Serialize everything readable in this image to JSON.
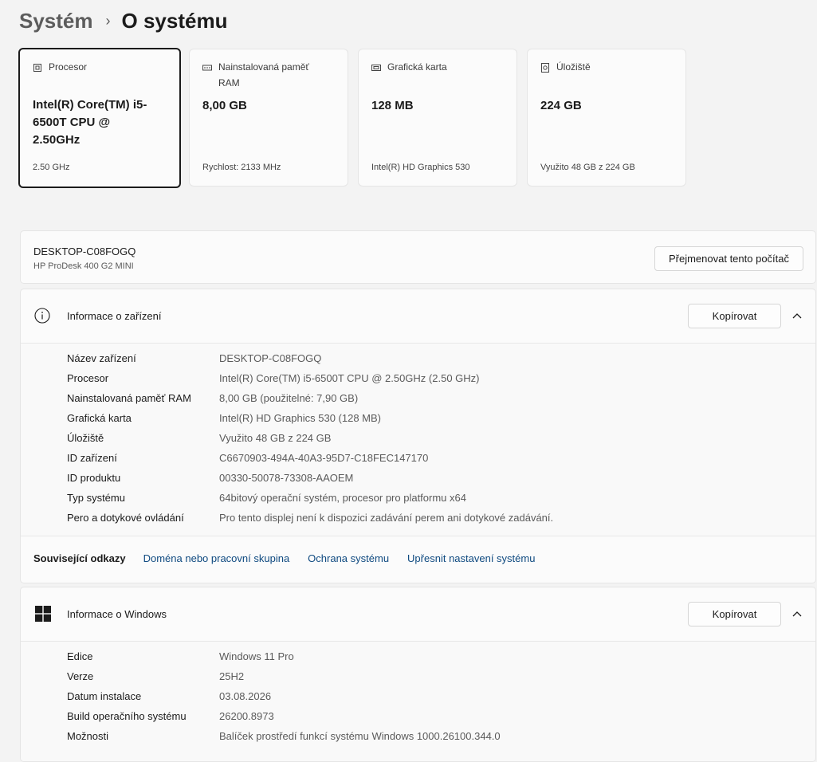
{
  "breadcrumb": {
    "parent": "Systém",
    "separator": "›",
    "current": "O systému"
  },
  "cards": [
    {
      "label": "Procesor",
      "value": "Intel(R) Core(TM) i5-6500T CPU @ 2.50GHz",
      "sub": "2.50 GHz",
      "icon": "processor-icon"
    },
    {
      "label": "Nainstalovaná paměť RAM",
      "value": "8,00 GB",
      "sub": "Rychlost: 2133 MHz",
      "icon": "memory-icon"
    },
    {
      "label": "Grafická karta",
      "value": "128 MB",
      "sub": "Intel(R) HD Graphics 530",
      "icon": "graphics-card-icon"
    },
    {
      "label": "Úložiště",
      "value": "224 GB",
      "sub": "Využito 48 GB z 224 GB",
      "icon": "storage-icon"
    }
  ],
  "pc": {
    "name": "DESKTOP-C08FOGQ",
    "model": "HP ProDesk 400 G2 MINI",
    "rename_label": "Přejmenovat tento počítač"
  },
  "device_info": {
    "title": "Informace o zařízení",
    "copy_label": "Kopírovat",
    "rows": [
      {
        "key": "Název zařízení",
        "value": "DESKTOP-C08FOGQ"
      },
      {
        "key": "Procesor",
        "value": "Intel(R) Core(TM) i5-6500T CPU @ 2.50GHz (2.50 GHz)"
      },
      {
        "key": "Nainstalovaná paměť RAM",
        "value": "8,00 GB (použitelné: 7,90 GB)"
      },
      {
        "key": "Grafická karta",
        "value": "Intel(R) HD Graphics 530 (128 MB)"
      },
      {
        "key": "Úložiště",
        "value": "Využito 48 GB z 224 GB"
      },
      {
        "key": "ID zařízení",
        "value": "C6670903-494A-40A3-95D7-C18FEC147170"
      },
      {
        "key": "ID produktu",
        "value": "00330-50078-73308-AAOEM"
      },
      {
        "key": "Typ systému",
        "value": "64bitový operační systém, procesor pro platformu x64"
      },
      {
        "key": "Pero a dotykové ovládání",
        "value": "Pro tento displej není k dispozici zadávání perem ani dotykové zadávání."
      }
    ]
  },
  "related": {
    "label": "Související odkazy",
    "links": [
      "Doména nebo pracovní skupina",
      "Ochrana systému",
      "Upřesnit nastavení systému"
    ]
  },
  "windows_info": {
    "title": "Informace o Windows",
    "copy_label": "Kopírovat",
    "rows": [
      {
        "key": "Edice",
        "value": "Windows 11 Pro"
      },
      {
        "key": "Verze",
        "value": "25H2"
      },
      {
        "key": "Datum instalace",
        "value": "03.08.2026"
      },
      {
        "key": "Build operačního systému",
        "value": "26200.8973"
      },
      {
        "key": "Možnosti",
        "value": "Balíček prostředí funkcí systému Windows 1000.26100.344.0"
      }
    ]
  },
  "colors": {
    "link": "#0f4a80",
    "background": "#f3f3f3",
    "card": "#fbfbfb",
    "selected_border": "#1b1b1b"
  }
}
